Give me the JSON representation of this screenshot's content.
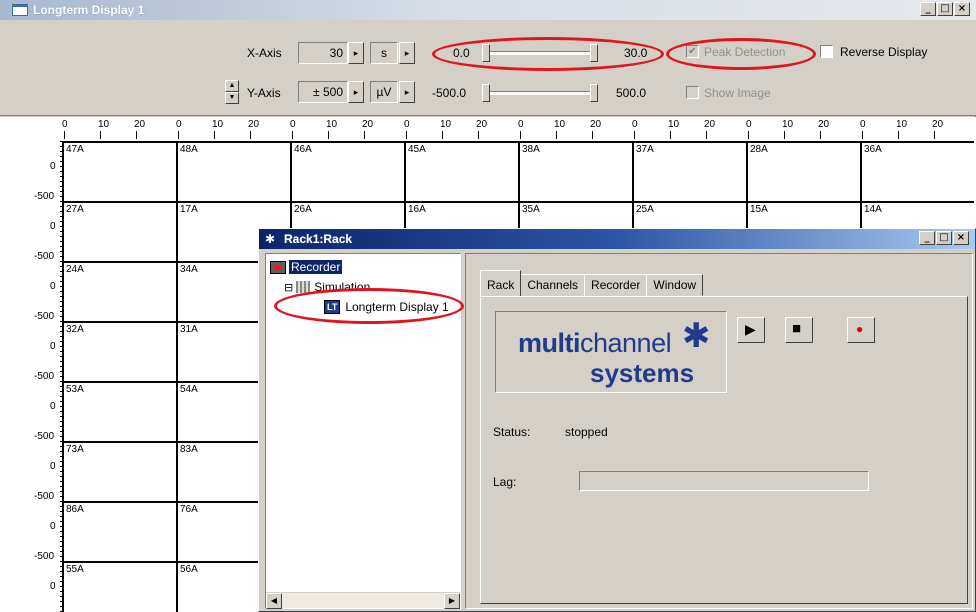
{
  "main_window": {
    "title": "Longterm Display 1",
    "caption_buttons": [
      "_",
      "□",
      "×"
    ]
  },
  "toolbar": {
    "x_axis_label": "X-Axis",
    "x_axis_value": "30",
    "x_axis_unit": "s",
    "x_range_min": "0.0",
    "x_range_max": "30.0",
    "y_axis_label": "Y-Axis",
    "y_axis_value": "± 500",
    "y_axis_unit": "µV",
    "y_range_min": "-500.0",
    "y_range_max": "500.0",
    "peak_detection_label": "Peak Detection",
    "peak_detection_checked": true,
    "reverse_display_label": "Reverse Display",
    "show_image_label": "Show Image",
    "spin_glyph": "▸"
  },
  "plot": {
    "x_ticks": [
      "0",
      "10",
      "20"
    ],
    "y_ticks": [
      "0",
      "-500"
    ],
    "rows": [
      [
        "47A",
        "48A",
        "46A",
        "45A",
        "38A",
        "37A",
        "28A",
        "36A"
      ],
      [
        "27A",
        "17A",
        "26A",
        "16A",
        "35A",
        "25A",
        "15A",
        "14A"
      ],
      [
        "24A",
        "34A",
        "",
        "",
        "",
        "",
        "",
        ""
      ],
      [
        "32A",
        "31A",
        "",
        "",
        "",
        "",
        "",
        ""
      ],
      [
        "53A",
        "54A",
        "",
        "",
        "",
        "",
        "",
        ""
      ],
      [
        "73A",
        "83A",
        "",
        "",
        "",
        "",
        "",
        ""
      ],
      [
        "86A",
        "76A",
        "",
        "",
        "",
        "",
        "",
        ""
      ],
      [
        "55A",
        "56A",
        "",
        "",
        "",
        "",
        "",
        ""
      ]
    ]
  },
  "rack_window": {
    "title": "Rack1:Rack",
    "tree": {
      "recorder": "Recorder",
      "simulation": "Simulation",
      "longterm_display": "Longterm Display 1",
      "lt_badge": "LT",
      "expander": "⊟"
    },
    "tabs": [
      {
        "label": "Rack",
        "active": true
      },
      {
        "label": "Channels",
        "active": false
      },
      {
        "label": "Recorder",
        "active": false
      },
      {
        "label": "Window",
        "active": false
      }
    ],
    "logo_line1_bold": "multi",
    "logo_line1_rest": "channel",
    "logo_line2": "systems",
    "status_label": "Status:",
    "status_value": "stopped",
    "lag_label": "Lag:",
    "play_glyph": "▶",
    "stop_glyph": "■",
    "record_glyph": "●",
    "scroll_left": "◀",
    "scroll_right": "▶"
  },
  "colors": {
    "annotation_red": "#e0141c",
    "logo_blue": "#1f3c8c",
    "record_red": "#e00000"
  }
}
